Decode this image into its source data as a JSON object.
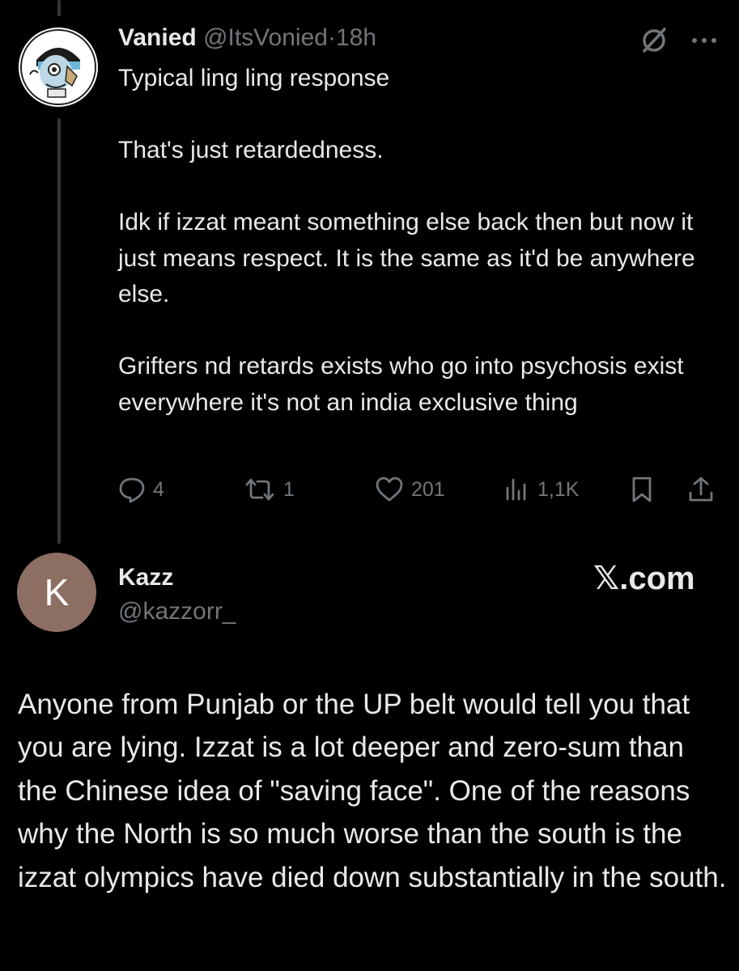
{
  "reply": {
    "author_name": "Vanied",
    "author_handle": "@ItsVonied",
    "separator": "·",
    "time": "18h",
    "paragraphs": [
      "Typical ling ling response",
      "That's just retardedness.",
      "Idk if izzat meant something else back then but now it just means respect. It is the same as it'd be anywhere else.",
      "Grifters nd retards exists who go into psychosis exist everywhere it's not an india exclusive thing"
    ],
    "stats": {
      "replies": "4",
      "reposts": "1",
      "likes": "201",
      "views": "1,1K"
    },
    "icons": [
      "grok-icon",
      "more-icon",
      "reply-icon",
      "retweet-icon",
      "like-icon",
      "views-icon",
      "bookmark-icon",
      "share-icon"
    ]
  },
  "original": {
    "avatar_letter": "K",
    "avatar_color": "#8d6e63",
    "author_name": "Kazz",
    "author_handle": "@kazzorr_",
    "watermark": "𝕏.com",
    "text": "Anyone from Punjab or the UP belt would tell you that you are lying. Izzat is a lot deeper and zero-sum than the Chinese idea of \"saving face\". One of the reasons why the North is so much worse than the south is the izzat olympics have died down substantially in the south."
  },
  "colors": {
    "background": "#000000",
    "text_primary": "#e7e9ea",
    "text_secondary": "#71767b",
    "thread_line": "#333639"
  }
}
